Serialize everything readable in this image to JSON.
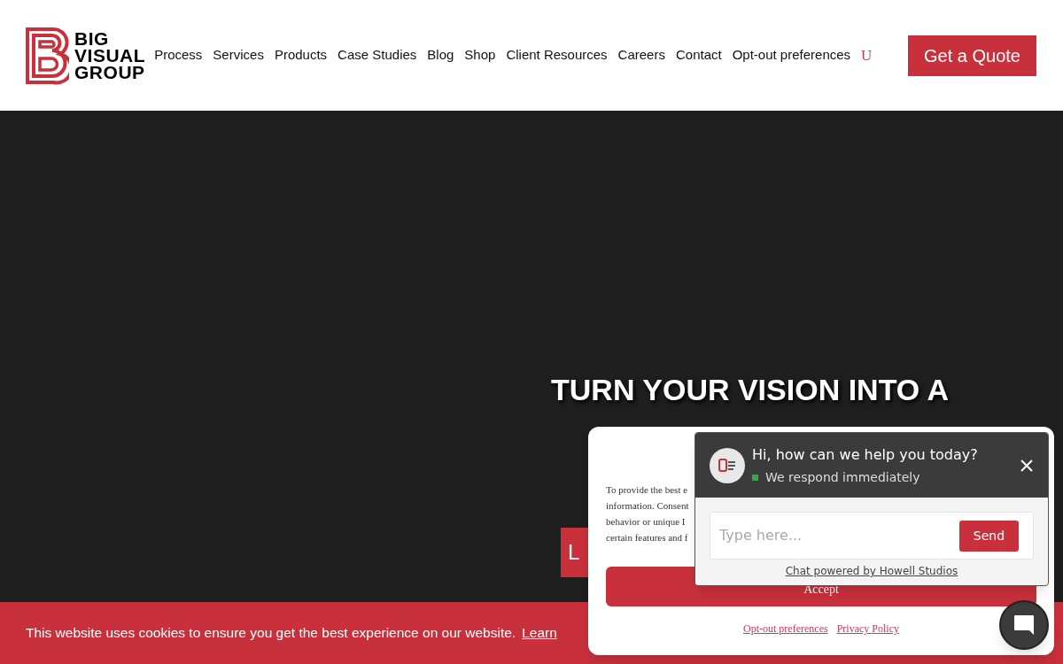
{
  "header": {
    "logo": {
      "lines": [
        "BIG",
        "VISUAL",
        "GROUP"
      ]
    },
    "nav": [
      {
        "label": "Process"
      },
      {
        "label": "Services"
      },
      {
        "label": "Products"
      },
      {
        "label": "Case Studies"
      },
      {
        "label": "Blog"
      },
      {
        "label": "Shop"
      },
      {
        "label": "Client Resources"
      },
      {
        "label": "Careers"
      },
      {
        "label": "Contact"
      },
      {
        "label": "Opt-out preferences"
      },
      {
        "label": "U",
        "kind": "accent"
      }
    ],
    "cta": "Get a Quote"
  },
  "hero": {
    "heading": "TURN YOUR VISION INTO A",
    "button": "L"
  },
  "consent_modal": {
    "text_lines": [
      "To provide the best e",
      "information. Consent",
      "behavior or unique I",
      "certain features and f"
    ],
    "accept": "Accept",
    "links": [
      "Opt-out preferences",
      "Privacy Policy"
    ]
  },
  "chat": {
    "title": "Hi, how can we help you today?",
    "status": "We respond immediately",
    "online": true,
    "placeholder": "Type here...",
    "send": "Send",
    "footer": "Chat powered by Howell Studios"
  },
  "cookie_bar": {
    "text": "This website uses cookies to ensure you get the best experience on our website.",
    "link": "Learn"
  }
}
